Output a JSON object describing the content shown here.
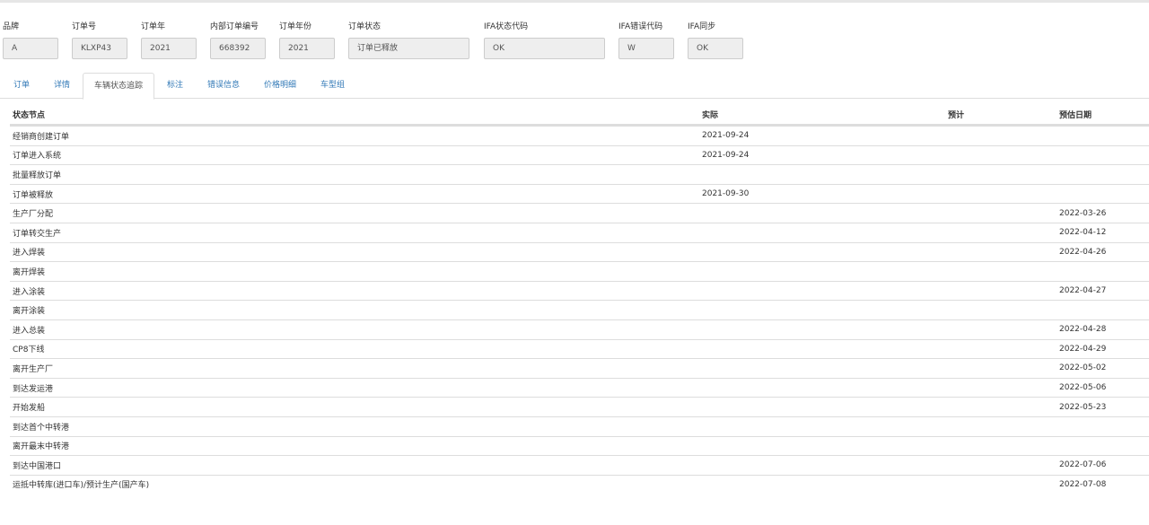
{
  "fields": [
    {
      "label": "品牌",
      "value": "A"
    },
    {
      "label": "订单号",
      "value": "KLXP43"
    },
    {
      "label": "订单年",
      "value": "2021"
    },
    {
      "label": "内部订单编号",
      "value": "668392"
    },
    {
      "label": "订单年份",
      "value": "2021"
    },
    {
      "label": "订单状态",
      "value": "订单已释放"
    },
    {
      "label": "IFA状态代码",
      "value": "OK"
    },
    {
      "label": "IFA错误代码",
      "value": "W"
    },
    {
      "label": "IFA同步",
      "value": "OK"
    }
  ],
  "tabs": [
    "订单",
    "详情",
    "车辆状态追踪",
    "标注",
    "错误信息",
    "价格明细",
    "车型组"
  ],
  "active_tab": "车辆状态追踪",
  "table": {
    "headers": {
      "node": "状态节点",
      "actual": "实际",
      "expected": "预计",
      "est_date": "预估日期"
    },
    "rows": [
      {
        "node": "经销商创建订单",
        "actual": "2021-09-24",
        "expected": "",
        "est_date": ""
      },
      {
        "node": "订单进入系统",
        "actual": "2021-09-24",
        "expected": "",
        "est_date": ""
      },
      {
        "node": "批量释放订单",
        "actual": "",
        "expected": "",
        "est_date": ""
      },
      {
        "node": "订单被释放",
        "actual": "2021-09-30",
        "expected": "",
        "est_date": ""
      },
      {
        "node": "生产厂分配",
        "actual": "",
        "expected": "",
        "est_date": "2022-03-26"
      },
      {
        "node": "订单转交生产",
        "actual": "",
        "expected": "",
        "est_date": "2022-04-12"
      },
      {
        "node": "进入焊装",
        "actual": "",
        "expected": "",
        "est_date": "2022-04-26"
      },
      {
        "node": "离开焊装",
        "actual": "",
        "expected": "",
        "est_date": ""
      },
      {
        "node": "进入涂装",
        "actual": "",
        "expected": "",
        "est_date": "2022-04-27"
      },
      {
        "node": "离开涂装",
        "actual": "",
        "expected": "",
        "est_date": ""
      },
      {
        "node": "进入总装",
        "actual": "",
        "expected": "",
        "est_date": "2022-04-28"
      },
      {
        "node": "CP8下线",
        "actual": "",
        "expected": "",
        "est_date": "2022-04-29"
      },
      {
        "node": "离开生产厂",
        "actual": "",
        "expected": "",
        "est_date": "2022-05-02"
      },
      {
        "node": "到达发运港",
        "actual": "",
        "expected": "",
        "est_date": "2022-05-06"
      },
      {
        "node": "开始发船",
        "actual": "",
        "expected": "",
        "est_date": "2022-05-23"
      },
      {
        "node": "到达首个中转港",
        "actual": "",
        "expected": "",
        "est_date": ""
      },
      {
        "node": "离开最末中转港",
        "actual": "",
        "expected": "",
        "est_date": ""
      },
      {
        "node": "到达中国港口",
        "actual": "",
        "expected": "",
        "est_date": "2022-07-06"
      },
      {
        "node": "运抵中转库(进口车)/预计生产(国产车)",
        "actual": "",
        "expected": "",
        "est_date": "2022-07-08"
      }
    ]
  }
}
